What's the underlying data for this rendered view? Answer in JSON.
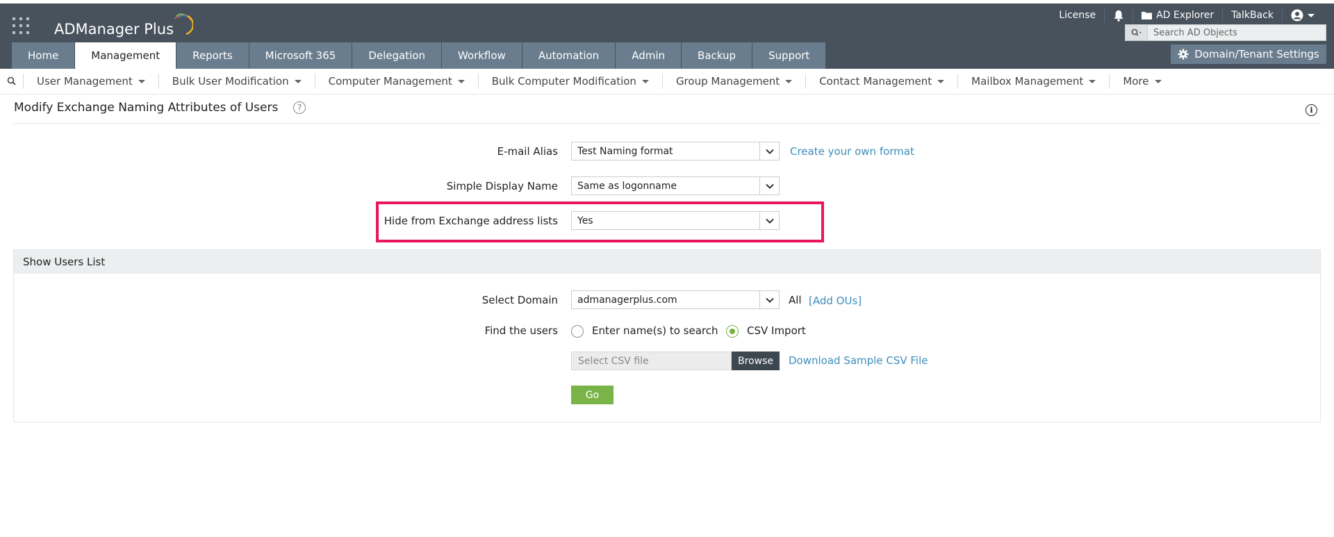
{
  "app": {
    "name": "ADManager Plus",
    "accent": "#7ab448",
    "header_bg": "#47525c",
    "highlight_color": "#e8175d"
  },
  "toplinks": {
    "license": "License",
    "notifications_icon": "bell-icon",
    "ad_explorer": "AD Explorer",
    "talkback": "TalkBack",
    "user_icon": "user-icon"
  },
  "search": {
    "placeholder": "Search AD Objects"
  },
  "tabs": [
    {
      "label": "Home"
    },
    {
      "label": "Management",
      "active": true
    },
    {
      "label": "Reports"
    },
    {
      "label": "Microsoft 365"
    },
    {
      "label": "Delegation"
    },
    {
      "label": "Workflow"
    },
    {
      "label": "Automation"
    },
    {
      "label": "Admin"
    },
    {
      "label": "Backup"
    },
    {
      "label": "Support"
    }
  ],
  "domain_settings": {
    "label": "Domain/Tenant Settings",
    "icon": "gear-icon"
  },
  "subnav": [
    {
      "label": "User Management"
    },
    {
      "label": "Bulk User Modification"
    },
    {
      "label": "Computer Management"
    },
    {
      "label": "Bulk Computer Modification"
    },
    {
      "label": "Group Management"
    },
    {
      "label": "Contact Management"
    },
    {
      "label": "Mailbox Management"
    },
    {
      "label": "More"
    }
  ],
  "page": {
    "title": "Modify Exchange Naming Attributes of Users",
    "help_glyph": "?",
    "info_glyph": "i"
  },
  "form": {
    "email_alias": {
      "label": "E-mail Alias",
      "value": "Test Naming format",
      "link": "Create your own format"
    },
    "simple_display_name": {
      "label": "Simple Display Name",
      "value": "Same as logonname"
    },
    "hide_from_lists": {
      "label": "Hide from Exchange address lists",
      "value": "Yes"
    }
  },
  "users_panel": {
    "heading": "Show Users List",
    "select_domain": {
      "label": "Select Domain",
      "value": "admanagerplus.com",
      "scope": "All",
      "add_ous": "[Add OUs]"
    },
    "find_users": {
      "label": "Find the users",
      "options": [
        {
          "label": "Enter name(s) to search",
          "checked": false
        },
        {
          "label": "CSV Import",
          "checked": true
        }
      ]
    },
    "csv": {
      "placeholder": "Select CSV file",
      "browse": "Browse",
      "sample_link": "Download Sample CSV File"
    },
    "go": "Go"
  }
}
